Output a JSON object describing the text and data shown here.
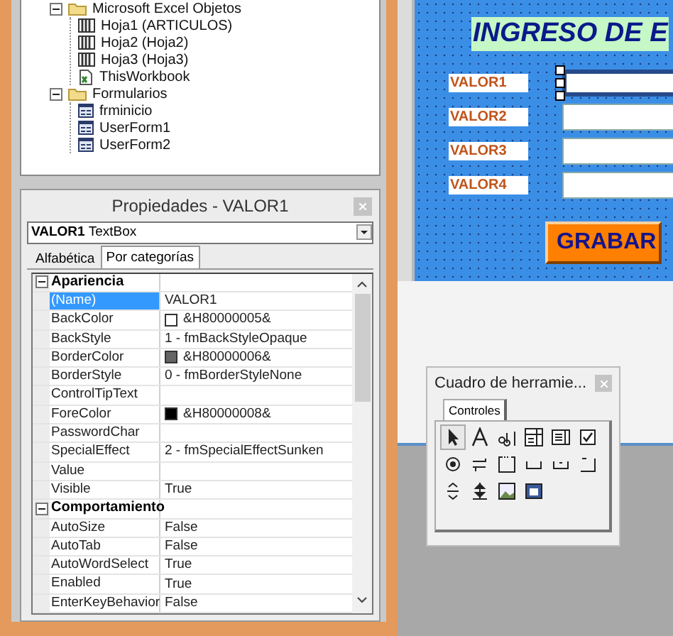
{
  "project_tree": {
    "items": [
      {
        "label": "Microsoft Excel Objetos",
        "kind": "folder",
        "expanded": true,
        "children": [
          {
            "label": "Hoja1 (ARTICULOS)",
            "kind": "sheet"
          },
          {
            "label": "Hoja2 (Hoja2)",
            "kind": "sheet"
          },
          {
            "label": "Hoja3 (Hoja3)",
            "kind": "sheet"
          },
          {
            "label": "ThisWorkbook",
            "kind": "workbook"
          }
        ]
      },
      {
        "label": "Formularios",
        "kind": "folder",
        "expanded": true,
        "children": [
          {
            "label": "frminicio",
            "kind": "form"
          },
          {
            "label": "UserForm1",
            "kind": "form"
          },
          {
            "label": "UserForm2",
            "kind": "form"
          }
        ]
      }
    ]
  },
  "properties": {
    "title": "Propiedades - VALOR1",
    "object": {
      "name": "VALOR1",
      "type": "TextBox"
    },
    "tabs": [
      {
        "label": "Alfabética",
        "selected": false
      },
      {
        "label": "Por categorías",
        "selected": true
      }
    ],
    "rows": [
      {
        "kind": "category",
        "label": "Apariencia",
        "expanded": true
      },
      {
        "kind": "property",
        "name": "(Name)",
        "value": "VALOR1",
        "selected": true
      },
      {
        "kind": "property",
        "name": "BackColor",
        "value": "&H80000005&",
        "color": "#ffffff",
        "selected": false
      },
      {
        "kind": "property",
        "name": "BackStyle",
        "value": "1 - fmBackStyleOpaque",
        "selected": false
      },
      {
        "kind": "property",
        "name": "BorderColor",
        "value": "&H80000006&",
        "color": "#646464",
        "selected": false
      },
      {
        "kind": "property",
        "name": "BorderStyle",
        "value": "0 - fmBorderStyleNone",
        "selected": false
      },
      {
        "kind": "property",
        "name": "ControlTipText",
        "selected": false
      },
      {
        "kind": "property",
        "name": "ForeColor",
        "value": "&H80000008&",
        "color": "#000000",
        "selected": false
      },
      {
        "kind": "property",
        "name": "PasswordChar",
        "selected": false
      },
      {
        "kind": "property",
        "name": "SpecialEffect",
        "value": "2 - fmSpecialEffectSunken",
        "selected": false
      },
      {
        "kind": "property",
        "name": "Value",
        "selected": false
      },
      {
        "kind": "property",
        "name": "Visible",
        "value": "True",
        "selected": false
      },
      {
        "kind": "category",
        "label": "Comportamiento",
        "expanded": true
      },
      {
        "kind": "property",
        "name": "AutoSize",
        "value": "False",
        "selected": false
      },
      {
        "kind": "property",
        "name": "AutoTab",
        "value": "False",
        "selected": false
      },
      {
        "kind": "property",
        "name": "AutoWordSelect",
        "value": "True",
        "selected": false
      },
      {
        "kind": "property",
        "name": "Enabled",
        "value": "True",
        "selected": false
      },
      {
        "kind": "property",
        "name": "EnterKeyBehavior",
        "value": "False",
        "selected": false
      }
    ]
  },
  "form": {
    "title": "INGRESO DE E",
    "fields": [
      {
        "label": "VALOR1",
        "selected": true
      },
      {
        "label": "VALOR2",
        "selected": false
      },
      {
        "label": "VALOR3",
        "selected": false
      },
      {
        "label": "VALOR4",
        "selected": false
      }
    ],
    "button": "GRABAR"
  },
  "toolbox": {
    "title": "Cuadro de herramie...",
    "tabs": [
      {
        "label": "Controles",
        "selected": true
      }
    ],
    "tools": [
      {
        "kind": "pointer",
        "selected": true
      },
      {
        "kind": "label",
        "selected": false
      },
      {
        "kind": "textbox",
        "selected": false
      },
      {
        "kind": "combobox",
        "selected": false
      },
      {
        "kind": "listbox",
        "selected": false
      },
      {
        "kind": "checkbox",
        "selected": false
      },
      {
        "kind": "optionbutton",
        "selected": false
      },
      {
        "kind": "togglebutton",
        "selected": false
      },
      {
        "kind": "frame",
        "selected": false
      },
      {
        "kind": "commandbutton",
        "selected": false
      },
      {
        "kind": "tabstrip",
        "selected": false
      },
      {
        "kind": "multipage",
        "selected": false
      },
      {
        "kind": "scrollbar",
        "selected": false
      },
      {
        "kind": "spinbutton",
        "selected": false
      },
      {
        "kind": "image",
        "selected": false
      },
      {
        "kind": "refedit",
        "selected": false
      }
    ]
  }
}
